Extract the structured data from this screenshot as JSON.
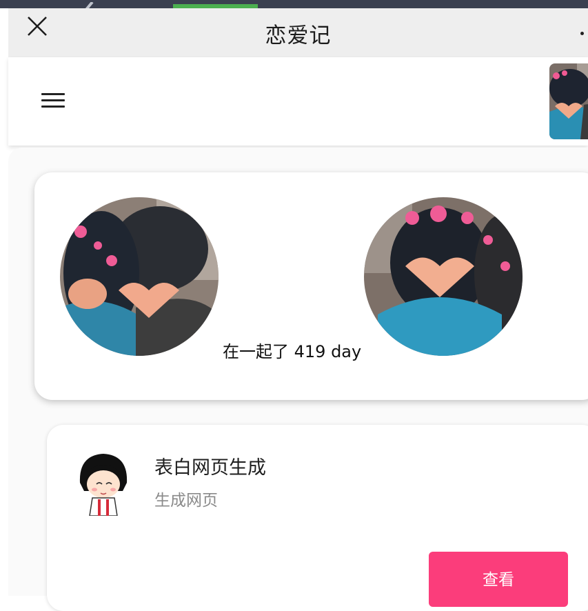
{
  "nav": {
    "title": "恋爱记",
    "close_icon": "close-icon",
    "more_icon": "more-dots-icon"
  },
  "header": {
    "menu_icon": "hamburger-menu-icon",
    "avatar": "couple-photo-thumbnail"
  },
  "couple": {
    "together_text": "在一起了 419 day",
    "left_avatar": "couple-photo-boy",
    "right_avatar": "couple-photo-girl"
  },
  "feature": {
    "icon": "maruko-character-icon",
    "title": "表白网页生成",
    "subtitle": "生成网页",
    "button_label": "查看"
  },
  "colors": {
    "accent_pink": "#fb3d7b",
    "progress_green": "#4caf50",
    "titlebar_grey": "#eeeeee"
  }
}
